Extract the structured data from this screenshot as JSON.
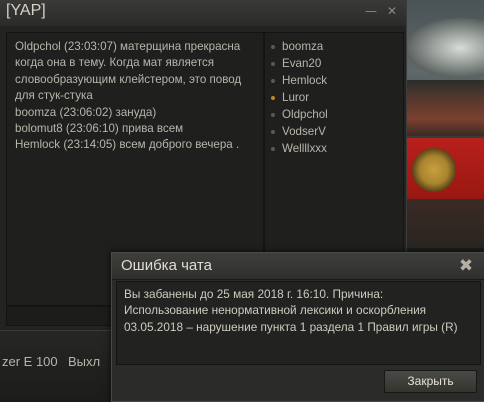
{
  "chat": {
    "title": "[YAP]",
    "messages": [
      "Oldpchol (23:03:07) матерщина прекрасна",
      "когда она в тему. Когда мат является",
      "словообразующим клейстером, это повод",
      "для стук-стука",
      "boomza (23:06:02) зануда)",
      "bolomut8 (23:06:10) прива всем",
      "Hemlock (23:14:05) всем доброго вечера ."
    ],
    "members": [
      "boomza",
      "Evan20",
      "Hemlock",
      "Luror",
      "Oldpchol",
      "VodserV",
      "Wellllxxx"
    ]
  },
  "background": {
    "tank_name": "zer E 100",
    "right_text": "Выхл"
  },
  "dialog": {
    "title": "Ошибка чата",
    "lines": [
      "Вы забанены до 25 мая 2018 г. 16:10. Причина:",
      "Использование ненормативной лексики и оскорбления",
      "03.05.2018 – нарушение пункта 1 раздела 1 Правил игры (R)"
    ],
    "close_label": "Закрыть"
  }
}
